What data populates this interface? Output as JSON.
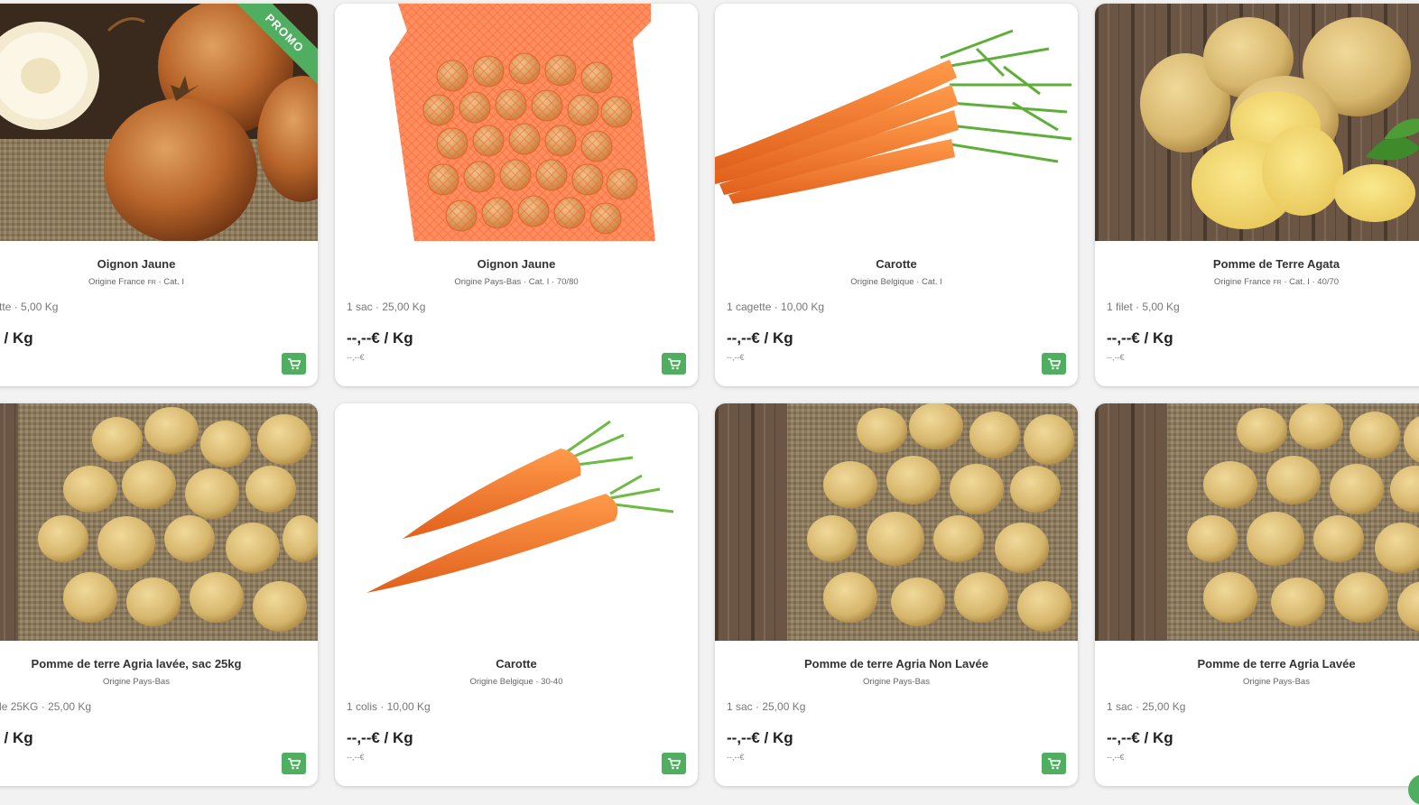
{
  "colors": {
    "accent": "#4fae5f",
    "card_bg": "#ffffff",
    "page_bg": "#f2f2f2"
  },
  "promo_label": "PROMO",
  "products": [
    {
      "title": "Oignon Jaune",
      "origin": "Origine France",
      "flag": "FR",
      "origin_suffix": " · Cat. I",
      "quantity": "1 cagette · 5,00 Kg",
      "price": "--,--€ / Kg",
      "sub_price": "--,--€",
      "image": "onion-image"
    },
    {
      "title": "Oignon Jaune",
      "origin": "Origine Pays-Bas · Cat. I · 70/80",
      "flag": "",
      "origin_suffix": "",
      "quantity": "1 sac · 25,00 Kg",
      "price": "--,--€ / Kg",
      "sub_price": "--,--€",
      "image": "onion-sack-image"
    },
    {
      "title": "Carotte",
      "origin": "Origine Belgique · Cat. I",
      "flag": "",
      "origin_suffix": "",
      "quantity": "1 cagette · 10,00 Kg",
      "price": "--,--€ / Kg",
      "sub_price": "--,--€",
      "image": "carrot-bunch-image"
    },
    {
      "title": "Pomme de Terre Agata",
      "origin": "Origine France",
      "flag": "FR",
      "origin_suffix": " · Cat. I · 40/70",
      "quantity": "1 filet · 5,00 Kg",
      "price": "--,--€ / Kg",
      "sub_price": "--,--€",
      "image": "potato-agata-image"
    },
    {
      "title": "Pomme de terre Agria lavée, sac 25kg",
      "origin": "Origine Pays-Bas",
      "flag": "",
      "origin_suffix": "",
      "quantity": "1 sac de 25KG · 25,00 Kg",
      "price": "--,--€ / Kg",
      "sub_price": "--,--€",
      "image": "potato-image"
    },
    {
      "title": "Carotte",
      "origin": "Origine Belgique · 30-40",
      "flag": "",
      "origin_suffix": "",
      "quantity": "1 colis · 10,00 Kg",
      "price": "--,--€ / Kg",
      "sub_price": "--,--€",
      "image": "carrot-image"
    },
    {
      "title": "Pomme de terre Agria Non Lavée",
      "origin": "Origine Pays-Bas",
      "flag": "",
      "origin_suffix": "",
      "quantity": "1 sac · 25,00 Kg",
      "price": "--,--€ / Kg",
      "sub_price": "--,--€",
      "image": "potato-image"
    },
    {
      "title": "Pomme de terre Agria Lavée",
      "origin": "Origine Pays-Bas",
      "flag": "",
      "origin_suffix": "",
      "quantity": "1 sac · 25,00 Kg",
      "price": "--,--€ / Kg",
      "sub_price": "--,--€",
      "image": "potato-image"
    }
  ]
}
